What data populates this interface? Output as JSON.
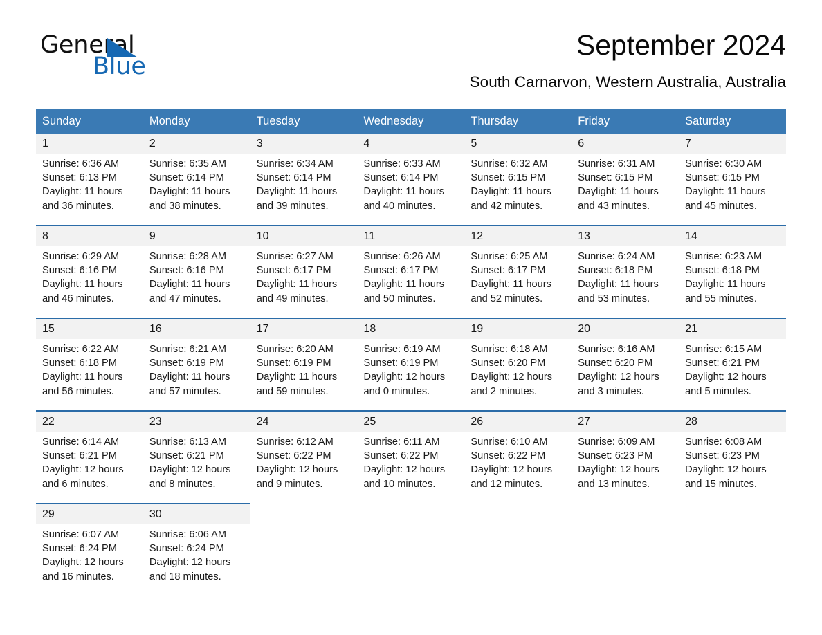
{
  "brand": {
    "word_general": "General",
    "word_blue": "Blue",
    "triangle_color": "#1668b3"
  },
  "header": {
    "title": "September 2024",
    "subtitle": "South Carnarvon, Western Australia, Australia",
    "header_bg": "#3a7ab4",
    "week_separator_color": "#2b6ca8",
    "daynum_bg": "#f2f2f2"
  },
  "weekdays": [
    "Sunday",
    "Monday",
    "Tuesday",
    "Wednesday",
    "Thursday",
    "Friday",
    "Saturday"
  ],
  "weeks": [
    {
      "days": [
        {
          "num": "1",
          "sunrise": "Sunrise: 6:36 AM",
          "sunset": "Sunset: 6:13 PM",
          "daylight_1": "Daylight: 11 hours",
          "daylight_2": "and 36 minutes."
        },
        {
          "num": "2",
          "sunrise": "Sunrise: 6:35 AM",
          "sunset": "Sunset: 6:14 PM",
          "daylight_1": "Daylight: 11 hours",
          "daylight_2": "and 38 minutes."
        },
        {
          "num": "3",
          "sunrise": "Sunrise: 6:34 AM",
          "sunset": "Sunset: 6:14 PM",
          "daylight_1": "Daylight: 11 hours",
          "daylight_2": "and 39 minutes."
        },
        {
          "num": "4",
          "sunrise": "Sunrise: 6:33 AM",
          "sunset": "Sunset: 6:14 PM",
          "daylight_1": "Daylight: 11 hours",
          "daylight_2": "and 40 minutes."
        },
        {
          "num": "5",
          "sunrise": "Sunrise: 6:32 AM",
          "sunset": "Sunset: 6:15 PM",
          "daylight_1": "Daylight: 11 hours",
          "daylight_2": "and 42 minutes."
        },
        {
          "num": "6",
          "sunrise": "Sunrise: 6:31 AM",
          "sunset": "Sunset: 6:15 PM",
          "daylight_1": "Daylight: 11 hours",
          "daylight_2": "and 43 minutes."
        },
        {
          "num": "7",
          "sunrise": "Sunrise: 6:30 AM",
          "sunset": "Sunset: 6:15 PM",
          "daylight_1": "Daylight: 11 hours",
          "daylight_2": "and 45 minutes."
        }
      ]
    },
    {
      "days": [
        {
          "num": "8",
          "sunrise": "Sunrise: 6:29 AM",
          "sunset": "Sunset: 6:16 PM",
          "daylight_1": "Daylight: 11 hours",
          "daylight_2": "and 46 minutes."
        },
        {
          "num": "9",
          "sunrise": "Sunrise: 6:28 AM",
          "sunset": "Sunset: 6:16 PM",
          "daylight_1": "Daylight: 11 hours",
          "daylight_2": "and 47 minutes."
        },
        {
          "num": "10",
          "sunrise": "Sunrise: 6:27 AM",
          "sunset": "Sunset: 6:17 PM",
          "daylight_1": "Daylight: 11 hours",
          "daylight_2": "and 49 minutes."
        },
        {
          "num": "11",
          "sunrise": "Sunrise: 6:26 AM",
          "sunset": "Sunset: 6:17 PM",
          "daylight_1": "Daylight: 11 hours",
          "daylight_2": "and 50 minutes."
        },
        {
          "num": "12",
          "sunrise": "Sunrise: 6:25 AM",
          "sunset": "Sunset: 6:17 PM",
          "daylight_1": "Daylight: 11 hours",
          "daylight_2": "and 52 minutes."
        },
        {
          "num": "13",
          "sunrise": "Sunrise: 6:24 AM",
          "sunset": "Sunset: 6:18 PM",
          "daylight_1": "Daylight: 11 hours",
          "daylight_2": "and 53 minutes."
        },
        {
          "num": "14",
          "sunrise": "Sunrise: 6:23 AM",
          "sunset": "Sunset: 6:18 PM",
          "daylight_1": "Daylight: 11 hours",
          "daylight_2": "and 55 minutes."
        }
      ]
    },
    {
      "days": [
        {
          "num": "15",
          "sunrise": "Sunrise: 6:22 AM",
          "sunset": "Sunset: 6:18 PM",
          "daylight_1": "Daylight: 11 hours",
          "daylight_2": "and 56 minutes."
        },
        {
          "num": "16",
          "sunrise": "Sunrise: 6:21 AM",
          "sunset": "Sunset: 6:19 PM",
          "daylight_1": "Daylight: 11 hours",
          "daylight_2": "and 57 minutes."
        },
        {
          "num": "17",
          "sunrise": "Sunrise: 6:20 AM",
          "sunset": "Sunset: 6:19 PM",
          "daylight_1": "Daylight: 11 hours",
          "daylight_2": "and 59 minutes."
        },
        {
          "num": "18",
          "sunrise": "Sunrise: 6:19 AM",
          "sunset": "Sunset: 6:19 PM",
          "daylight_1": "Daylight: 12 hours",
          "daylight_2": "and 0 minutes."
        },
        {
          "num": "19",
          "sunrise": "Sunrise: 6:18 AM",
          "sunset": "Sunset: 6:20 PM",
          "daylight_1": "Daylight: 12 hours",
          "daylight_2": "and 2 minutes."
        },
        {
          "num": "20",
          "sunrise": "Sunrise: 6:16 AM",
          "sunset": "Sunset: 6:20 PM",
          "daylight_1": "Daylight: 12 hours",
          "daylight_2": "and 3 minutes."
        },
        {
          "num": "21",
          "sunrise": "Sunrise: 6:15 AM",
          "sunset": "Sunset: 6:21 PM",
          "daylight_1": "Daylight: 12 hours",
          "daylight_2": "and 5 minutes."
        }
      ]
    },
    {
      "days": [
        {
          "num": "22",
          "sunrise": "Sunrise: 6:14 AM",
          "sunset": "Sunset: 6:21 PM",
          "daylight_1": "Daylight: 12 hours",
          "daylight_2": "and 6 minutes."
        },
        {
          "num": "23",
          "sunrise": "Sunrise: 6:13 AM",
          "sunset": "Sunset: 6:21 PM",
          "daylight_1": "Daylight: 12 hours",
          "daylight_2": "and 8 minutes."
        },
        {
          "num": "24",
          "sunrise": "Sunrise: 6:12 AM",
          "sunset": "Sunset: 6:22 PM",
          "daylight_1": "Daylight: 12 hours",
          "daylight_2": "and 9 minutes."
        },
        {
          "num": "25",
          "sunrise": "Sunrise: 6:11 AM",
          "sunset": "Sunset: 6:22 PM",
          "daylight_1": "Daylight: 12 hours",
          "daylight_2": "and 10 minutes."
        },
        {
          "num": "26",
          "sunrise": "Sunrise: 6:10 AM",
          "sunset": "Sunset: 6:22 PM",
          "daylight_1": "Daylight: 12 hours",
          "daylight_2": "and 12 minutes."
        },
        {
          "num": "27",
          "sunrise": "Sunrise: 6:09 AM",
          "sunset": "Sunset: 6:23 PM",
          "daylight_1": "Daylight: 12 hours",
          "daylight_2": "and 13 minutes."
        },
        {
          "num": "28",
          "sunrise": "Sunrise: 6:08 AM",
          "sunset": "Sunset: 6:23 PM",
          "daylight_1": "Daylight: 12 hours",
          "daylight_2": "and 15 minutes."
        }
      ]
    },
    {
      "days": [
        {
          "num": "29",
          "sunrise": "Sunrise: 6:07 AM",
          "sunset": "Sunset: 6:24 PM",
          "daylight_1": "Daylight: 12 hours",
          "daylight_2": "and 16 minutes."
        },
        {
          "num": "30",
          "sunrise": "Sunrise: 6:06 AM",
          "sunset": "Sunset: 6:24 PM",
          "daylight_1": "Daylight: 12 hours",
          "daylight_2": "and 18 minutes."
        },
        {
          "num": "",
          "sunrise": "",
          "sunset": "",
          "daylight_1": "",
          "daylight_2": ""
        },
        {
          "num": "",
          "sunrise": "",
          "sunset": "",
          "daylight_1": "",
          "daylight_2": ""
        },
        {
          "num": "",
          "sunrise": "",
          "sunset": "",
          "daylight_1": "",
          "daylight_2": ""
        },
        {
          "num": "",
          "sunrise": "",
          "sunset": "",
          "daylight_1": "",
          "daylight_2": ""
        },
        {
          "num": "",
          "sunrise": "",
          "sunset": "",
          "daylight_1": "",
          "daylight_2": ""
        }
      ]
    }
  ]
}
